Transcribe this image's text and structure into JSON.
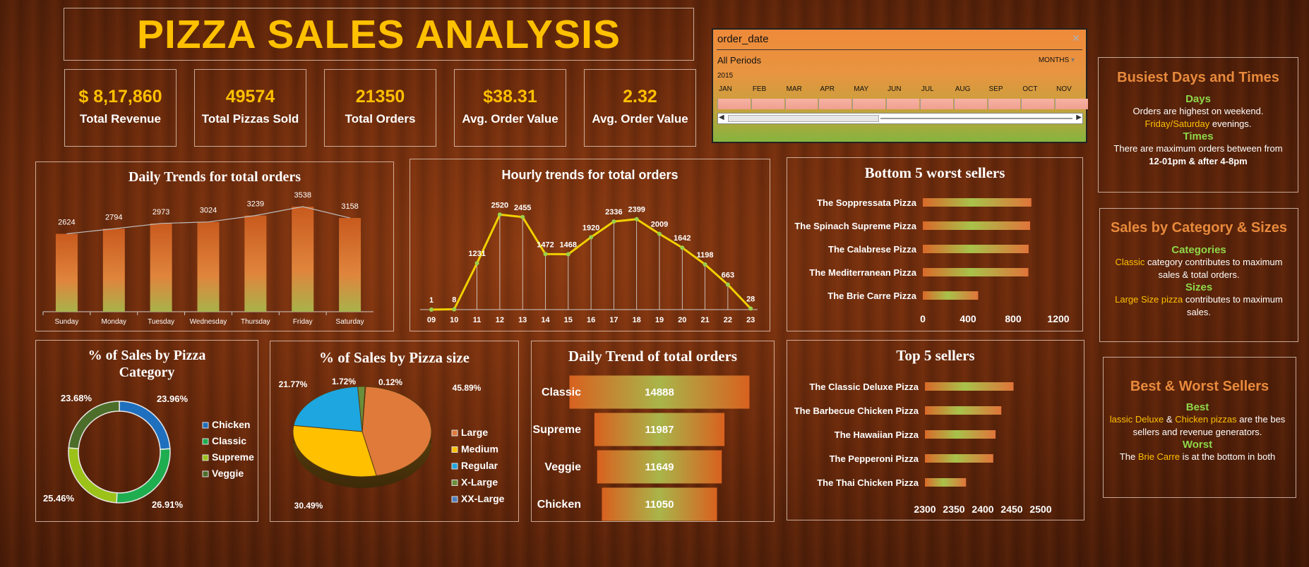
{
  "header": {
    "title": "PIZZA SALES ANALYSIS"
  },
  "kpis": [
    {
      "value": "$ 8,17,860",
      "label": "Total Revenue"
    },
    {
      "value": "49574",
      "label": "Total Pizzas Sold"
    },
    {
      "value": "21350",
      "label": "Total Orders"
    },
    {
      "value": "$38.31",
      "label": "Avg. Order Value"
    },
    {
      "value": "2.32",
      "label": "Avg. Order Value"
    }
  ],
  "slicer": {
    "field": "order_date",
    "period": "All Periods",
    "level": "MONTHS",
    "year": "2015",
    "months": [
      "JAN",
      "FEB",
      "MAR",
      "APR",
      "MAY",
      "JUN",
      "JUL",
      "AUG",
      "SEP",
      "OCT",
      "NOV"
    ]
  },
  "notes": {
    "busiest": {
      "title": "Busiest Days and Times",
      "days_head": "Days",
      "days_text1": "Orders are highest on weekend.",
      "days_hl": "Friday/Saturday",
      "days_text2": " evenings.",
      "times_head": "Times",
      "times_text": "There are maximum orders between from",
      "times_hl": "12-01pm & after 4-8pm"
    },
    "category": {
      "title": "Sales by Category & Sizes",
      "cat_head": "Categories",
      "cat_hl": "Classic",
      "cat_text": " category contributes to maximum sales & total orders.",
      "size_head": "Sizes",
      "size_hl": "Large Size pizza",
      "size_text": " contributes to maximum sales."
    },
    "sellers": {
      "title": "Best & Worst Sellers",
      "best_head": "Best",
      "best_hl1": "lassic Deluxe",
      "best_mid": " & ",
      "best_hl2": "Chicken pizzas",
      "best_text": " are the bes sellers and revenue generators.",
      "worst_head": "Worst",
      "worst_pre": "The ",
      "worst_hl": "Brie Carre",
      "worst_text": " is at the bottom in both"
    }
  },
  "chart_data": [
    {
      "type": "bar",
      "title": "Daily Trends for total orders",
      "categories": [
        "Sunday",
        "Monday",
        "Tuesday",
        "Wednesday",
        "Thursday",
        "Friday",
        "Saturday"
      ],
      "values": [
        2624,
        2794,
        2973,
        3024,
        3239,
        3538,
        3158
      ],
      "ylim": [
        0,
        3800
      ]
    },
    {
      "type": "line",
      "title": "Hourly trends for total orders",
      "x": [
        "09",
        "10",
        "11",
        "12",
        "13",
        "14",
        "15",
        "16",
        "17",
        "18",
        "19",
        "20",
        "21",
        "22",
        "23"
      ],
      "values": [
        1,
        8,
        1231,
        2520,
        2455,
        1472,
        1468,
        1920,
        2336,
        2399,
        2009,
        1642,
        1198,
        663,
        28
      ],
      "ylim": [
        0,
        2600
      ]
    },
    {
      "type": "bar",
      "orientation": "horizontal",
      "title": "Bottom 5 worst sellers",
      "categories": [
        "The Soppressata Pizza",
        "The Spinach Supreme Pizza",
        "The Calabrese Pizza",
        "The Mediterranean Pizza",
        "The Brie Carre Pizza"
      ],
      "values": [
        961,
        950,
        937,
        934,
        490
      ],
      "xlim": [
        0,
        1200
      ],
      "xticks": [
        "0",
        "400",
        "800",
        "1200"
      ]
    },
    {
      "type": "pie",
      "style": "donut",
      "title": "% of Sales by Pizza Category",
      "labels": [
        "Chicken",
        "Classic",
        "Supreme",
        "Veggie"
      ],
      "values": [
        23.96,
        26.91,
        25.46,
        23.68
      ],
      "value_labels": [
        "23.96%",
        "26.91%",
        "25.46%",
        "23.68%"
      ],
      "colors": [
        "#1f6fbf",
        "#1fae4f",
        "#9cc21a",
        "#4d6e2a"
      ]
    },
    {
      "type": "pie",
      "style": "3d",
      "title": "% of Sales by Pizza size",
      "labels": [
        "Large",
        "Medium",
        "Regular",
        "X-Large",
        "XX-Large"
      ],
      "values": [
        45.89,
        30.49,
        21.77,
        1.72,
        0.12
      ],
      "value_labels": [
        "45.89%",
        "30.49%",
        "21.77%",
        "1.72%",
        "0.12%"
      ],
      "colors": [
        "#e07a3a",
        "#ffc000",
        "#1ea6e0",
        "#6b8e3a",
        "#4f7fc0"
      ]
    },
    {
      "type": "bar",
      "orientation": "funnel",
      "title": "Daily Trend of total orders",
      "categories": [
        "Classic",
        "Supreme",
        "Veggie",
        "Chicken"
      ],
      "values": [
        14888,
        11987,
        11649,
        11050
      ]
    },
    {
      "type": "bar",
      "orientation": "horizontal",
      "title": "Top 5 sellers",
      "categories": [
        "The Classic Deluxe Pizza",
        "The Barbecue Chicken Pizza",
        "The Hawaiian Pizza",
        "The Pepperoni Pizza",
        "The Thai Chicken Pizza"
      ],
      "values": [
        2453,
        2432,
        2422,
        2418,
        2371
      ],
      "xlim": [
        2300,
        2500
      ],
      "xticks": [
        "2300",
        "2350",
        "2400",
        "2450",
        "2500"
      ]
    }
  ]
}
